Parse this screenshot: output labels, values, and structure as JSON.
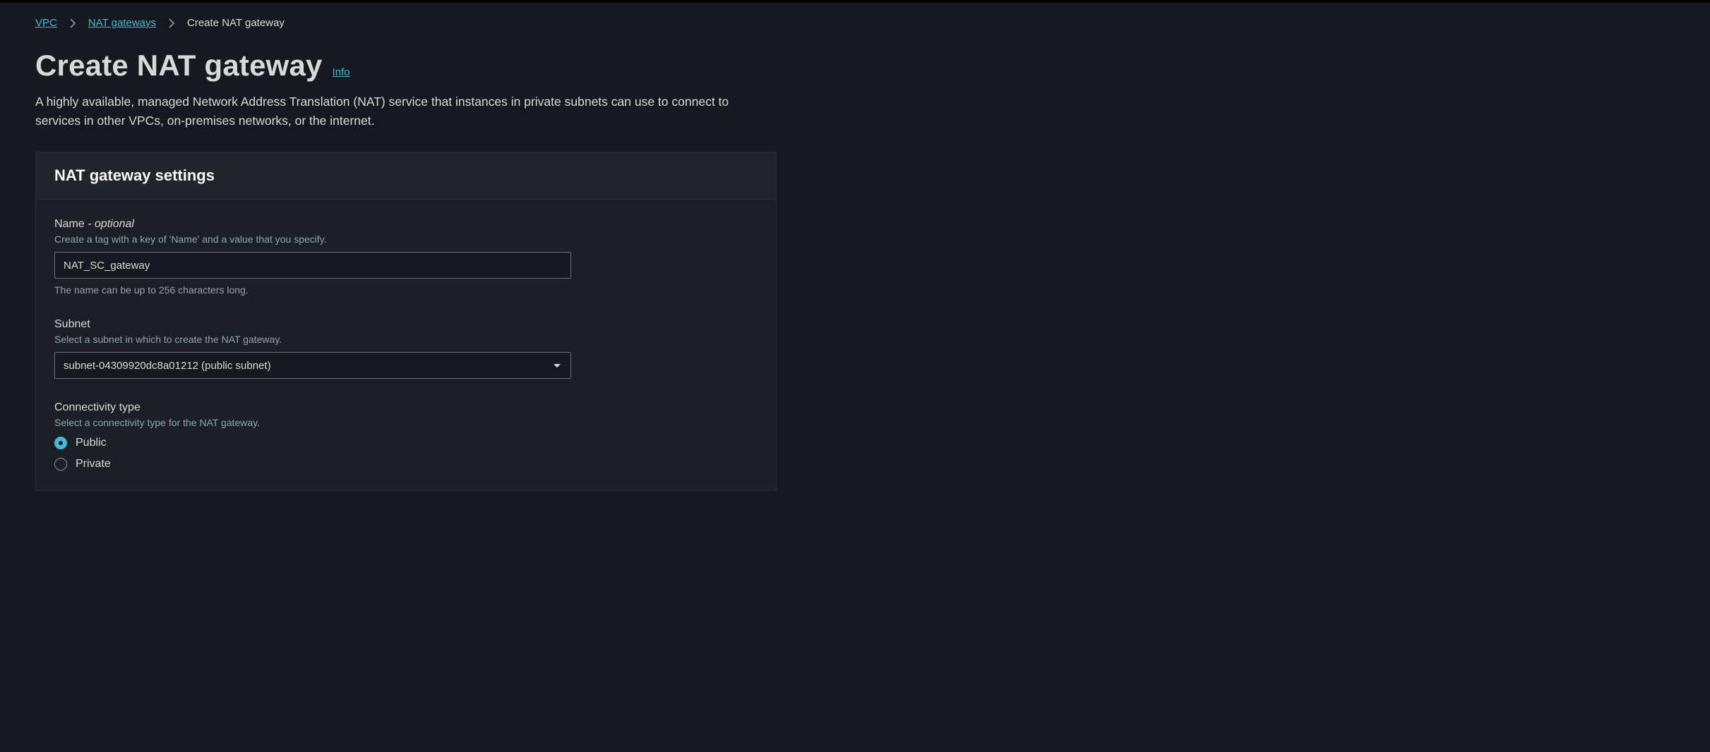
{
  "breadcrumb": {
    "items": [
      {
        "label": "VPC",
        "link": true
      },
      {
        "label": "NAT gateways",
        "link": true
      },
      {
        "label": "Create NAT gateway",
        "link": false
      }
    ]
  },
  "header": {
    "title": "Create NAT gateway",
    "info_label": "Info",
    "description": "A highly available, managed Network Address Translation (NAT) service that instances in private subnets can use to connect to services in other VPCs, on-premises networks, or the internet."
  },
  "panel": {
    "title": "NAT gateway settings"
  },
  "form": {
    "name": {
      "label": "Name",
      "optional_suffix": " - optional",
      "desc": "Create a tag with a key of 'Name' and a value that you specify.",
      "value": "NAT_SC_gateway",
      "hint": "The name can be up to 256 characters long."
    },
    "subnet": {
      "label": "Subnet",
      "desc": "Select a subnet in which to create the NAT gateway.",
      "value": "subnet-04309920dc8a01212 (public subnet)"
    },
    "connectivity": {
      "label": "Connectivity type",
      "desc": "Select a connectivity type for the NAT gateway.",
      "options": {
        "public": "Public",
        "private": "Private"
      },
      "selected": "public"
    }
  }
}
